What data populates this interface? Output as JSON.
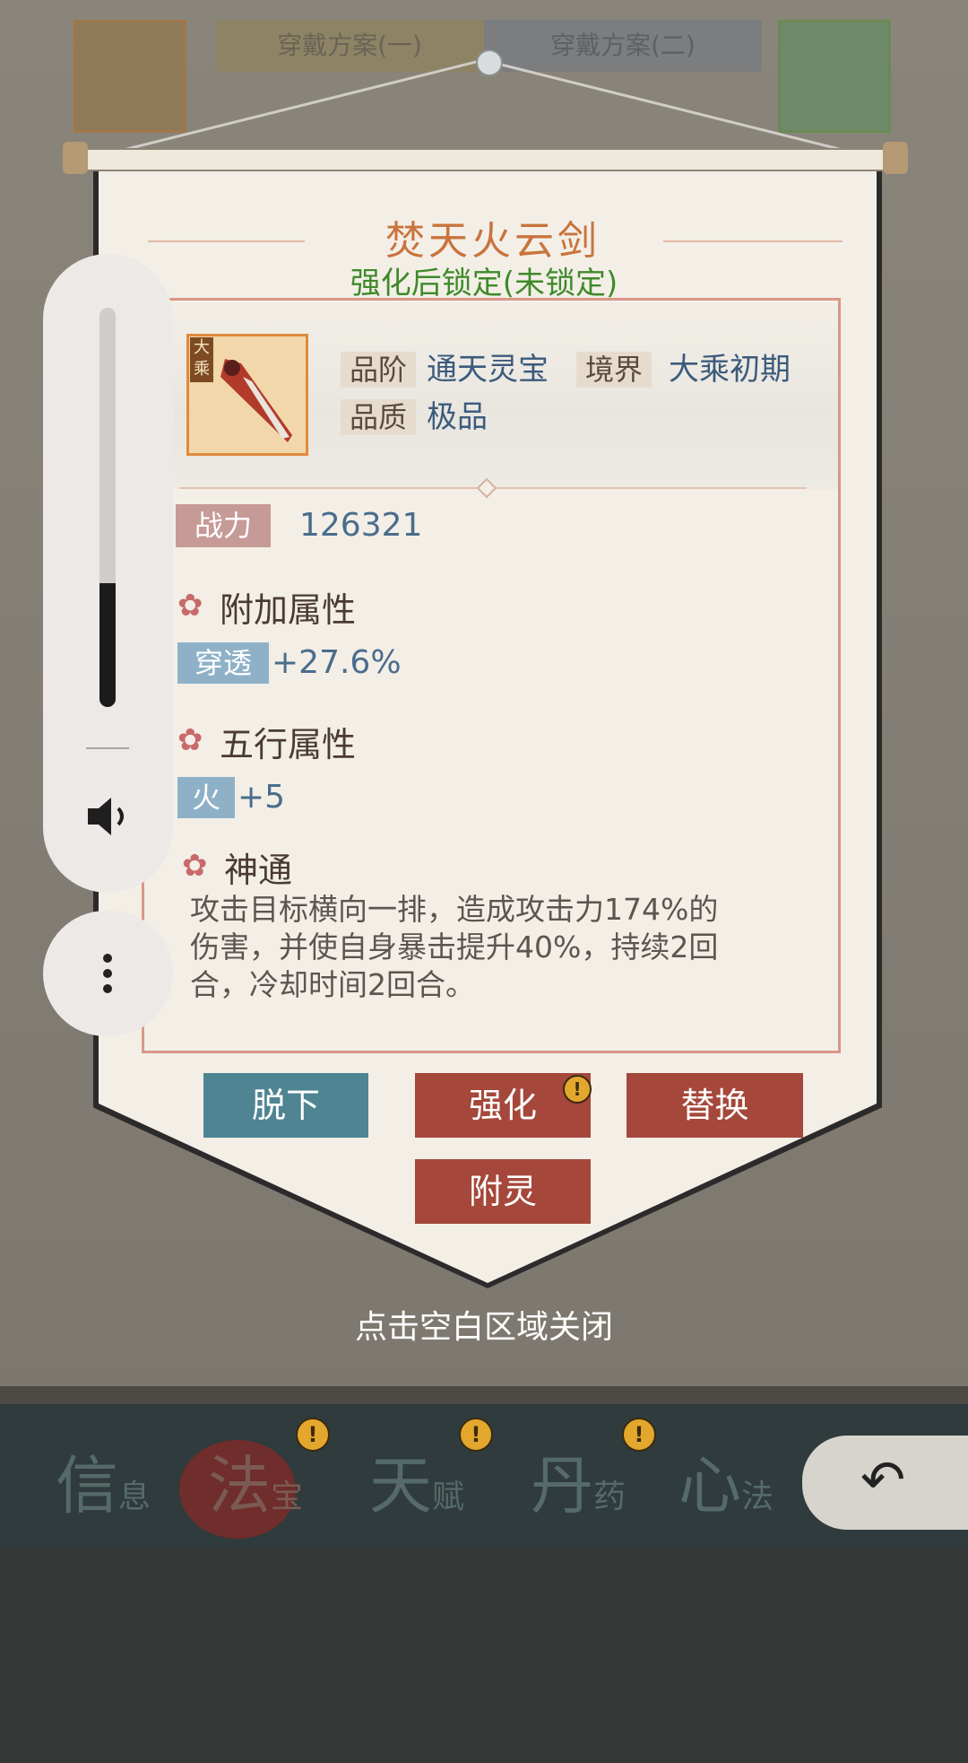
{
  "background": {
    "plan_tabs": [
      "穿戴方案(一)",
      "穿戴方案(二)"
    ],
    "bottom_nav": [
      {
        "big": "信",
        "small": "息",
        "badge": false,
        "active": false
      },
      {
        "big": "法",
        "small": "宝",
        "badge": true,
        "active": true
      },
      {
        "big": "天",
        "small": "赋",
        "badge": true,
        "active": false
      },
      {
        "big": "丹",
        "small": "药",
        "badge": true,
        "active": false
      },
      {
        "big": "心",
        "small": "法",
        "badge": false,
        "active": false
      }
    ],
    "badge_glyph": "!"
  },
  "item": {
    "name": "焚天火云剑",
    "lock_status": "强化后锁定(未锁定)",
    "tag": "大乘",
    "grade_label": "品阶",
    "grade_value": "通天灵宝",
    "realm_label": "境界",
    "realm_value": "大乘初期",
    "quality_label": "品质",
    "quality_value": "极品",
    "power_label": "战力",
    "power_value": "126321",
    "extra_attr_title": "附加属性",
    "extra_attr": {
      "name": "穿透",
      "value": "+27.6%"
    },
    "element_attr_title": "五行属性",
    "element_attr": {
      "name": "火",
      "value": "+5"
    },
    "skill_title": "神通",
    "skill_desc_lines": [
      "攻击目标横向一排，造成攻击力174%的",
      "伤害，并使自身暴击提升40%，持续2回",
      "合，冷却时间2回合。"
    ]
  },
  "buttons": {
    "unequip": "脱下",
    "enhance": "强化",
    "replace": "替换",
    "enchant": "附灵"
  },
  "close_hint": "点击空白区域关闭",
  "volume": {
    "level_percent": 31
  },
  "flower_glyph": "✿",
  "back_arrow": "↶"
}
